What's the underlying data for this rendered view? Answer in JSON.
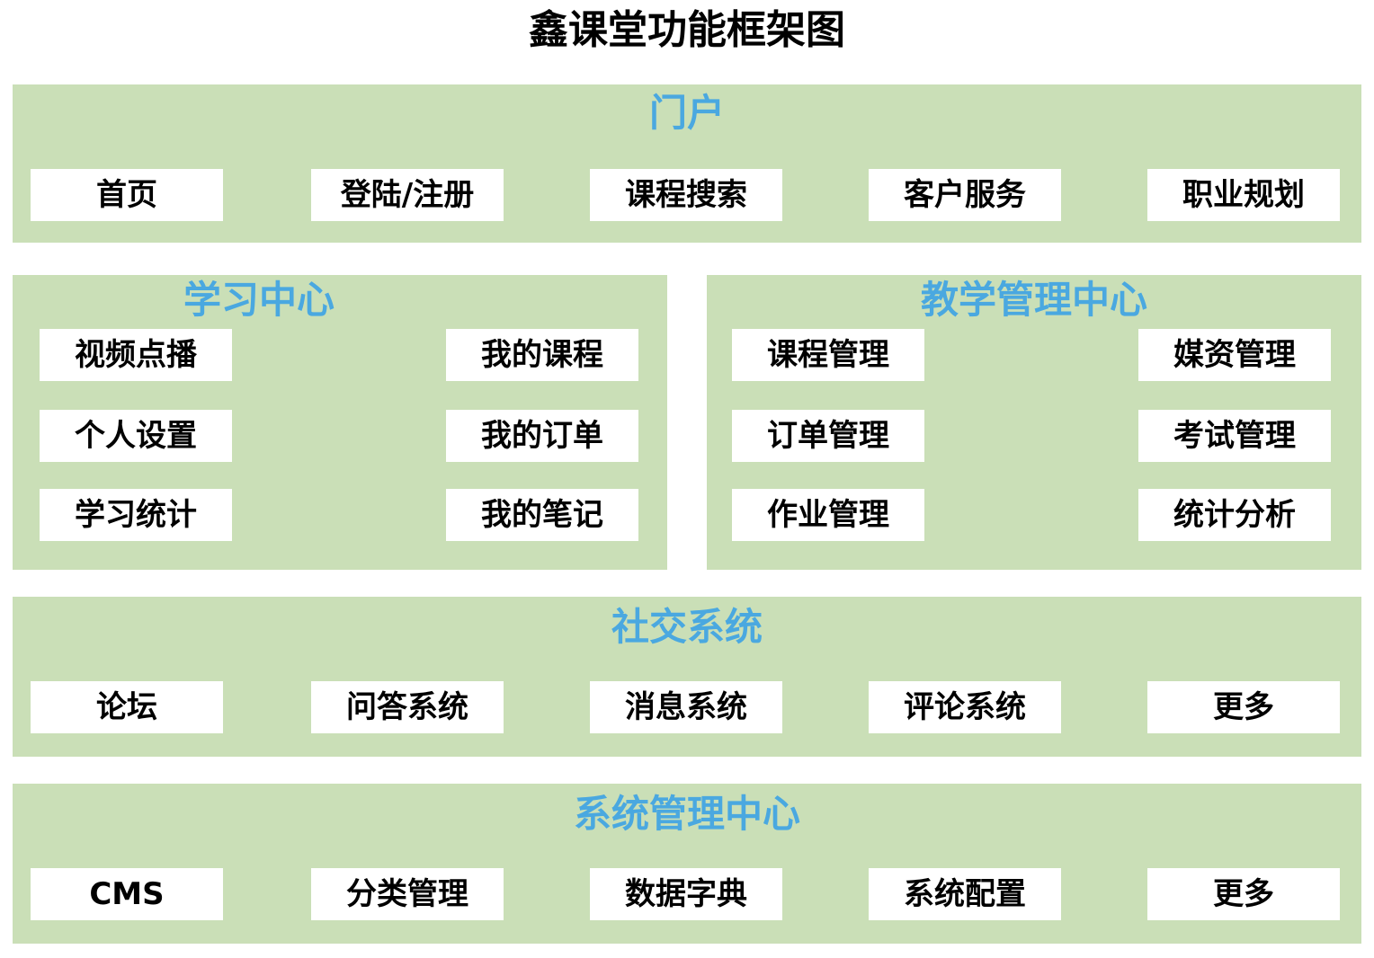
{
  "title": "鑫课堂功能框架图",
  "colors": {
    "panel_bg": "#cadfb7",
    "panel_title": "#4aa8e0",
    "box_bg": "#ffffff",
    "text": "#000000"
  },
  "portal": {
    "title": "门户",
    "items": [
      "首页",
      "登陆/注册",
      "课程搜索",
      "客户服务",
      "职业规划"
    ]
  },
  "learning_center": {
    "title": "学习中心",
    "left_items": [
      "视频点播",
      "个人设置",
      "学习统计"
    ],
    "right_items": [
      "我的课程",
      "我的订单",
      "我的笔记"
    ]
  },
  "teaching_center": {
    "title": "教学管理中心",
    "left_items": [
      "课程管理",
      "订单管理",
      "作业管理"
    ],
    "right_items": [
      "媒资管理",
      "考试管理",
      "统计分析"
    ]
  },
  "social": {
    "title": "社交系统",
    "items": [
      "论坛",
      "问答系统",
      "消息系统",
      "评论系统",
      "更多"
    ]
  },
  "system_center": {
    "title": "系统管理中心",
    "items": [
      "CMS",
      "分类管理",
      "数据字典",
      "系统配置",
      "更多"
    ]
  }
}
